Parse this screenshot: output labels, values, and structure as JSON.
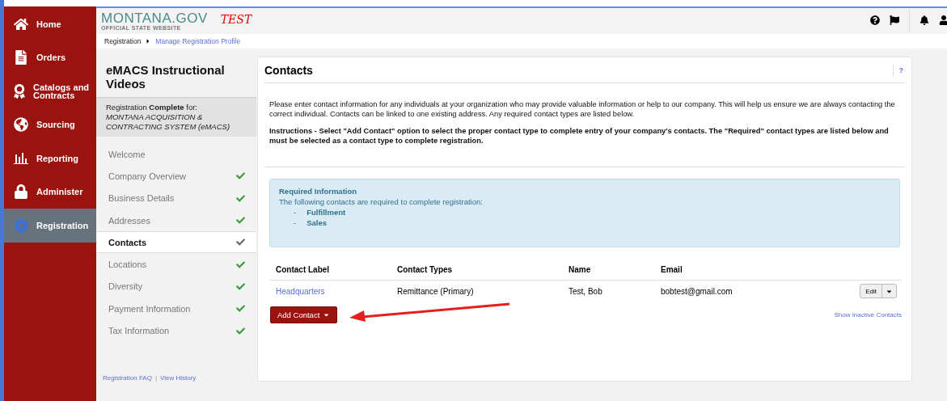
{
  "sidebar": {
    "items": [
      {
        "label": "Home",
        "selected": false
      },
      {
        "label": "Orders",
        "selected": false
      },
      {
        "label": "Catalogs and Contracts",
        "selected": false
      },
      {
        "label": "Sourcing",
        "selected": false
      },
      {
        "label": "Reporting",
        "selected": false
      },
      {
        "label": "Administer",
        "selected": false
      },
      {
        "label": "Registration",
        "selected": true
      }
    ]
  },
  "header": {
    "logo": "MONTANA.GOV",
    "logo_tagline": "OFFICIAL STATE WEBSITE",
    "environment": "TEST"
  },
  "breadcrumb": [
    {
      "label": "Registration",
      "link": false
    },
    {
      "label": "Manage Registration Profile",
      "link": true
    }
  ],
  "registration_nav": {
    "title": "eMACS Instructional Videos",
    "status": "Registration **Complete** for:",
    "organization": "MONTANA ACQUISITION & CONTRACTING SYSTEM (eMACS)",
    "steps": [
      {
        "label": "Welcome",
        "selected": false,
        "checked": false
      },
      {
        "label": "Company Overview",
        "selected": false,
        "checked": true
      },
      {
        "label": "Business Details",
        "selected": false,
        "checked": true
      },
      {
        "label": "Addresses",
        "selected": false,
        "checked": true
      },
      {
        "label": "Contacts",
        "selected": true,
        "checked": true
      },
      {
        "label": "Locations",
        "selected": false,
        "checked": true
      },
      {
        "label": "Diversity",
        "selected": false,
        "checked": true
      },
      {
        "label": "Payment Information",
        "selected": false,
        "checked": true
      },
      {
        "label": "Tax Information",
        "selected": false,
        "checked": true
      }
    ],
    "links": [
      "Registration FAQ",
      "View History"
    ],
    "link_separator": "|"
  },
  "contacts": {
    "title": "Contacts",
    "help": "?",
    "intro": "Please enter contact information for any individuals at your organization who may provide valuable information or help to our company. This will help us ensure we are always contacting the correct individual. Contacts can be linked to one existing address. Any required contact types are listed below.",
    "instructions": "Instructions - Select \"Add Contact\" option to select the proper contact type to complete entry of your company's contacts. The \"Required\" contact types are listed below and must be selected as a contact type to complete registration.",
    "required": {
      "title": "Required Information",
      "text": "The following contacts are required to complete registration:",
      "items": [
        "Fulfillment",
        "Sales"
      ],
      "bullet": "-"
    },
    "table": {
      "columns": [
        "Contact Label",
        "Contact Types",
        "Name",
        "Email"
      ],
      "rows": [
        {
          "label": "Headquarters",
          "types": "Remittance (Primary)",
          "name": "Test, Bob",
          "email": "bobtest@gmail.com",
          "action": "Edit"
        }
      ]
    },
    "add_button": "Add Contact",
    "inactive_link": "Show Inactive Contacts"
  }
}
